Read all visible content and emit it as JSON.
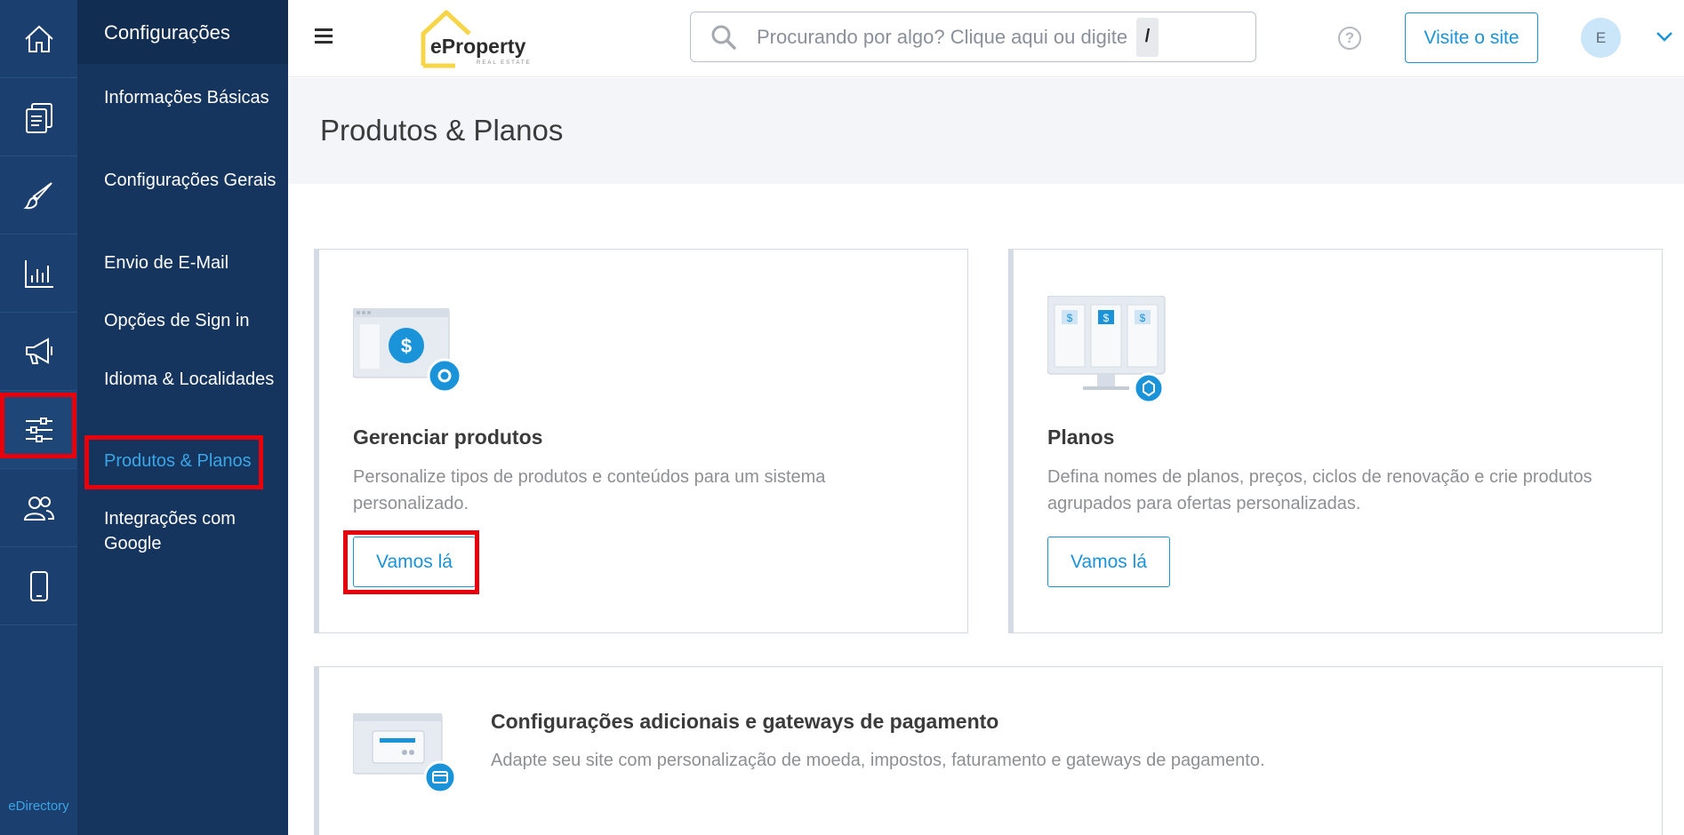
{
  "rail": {
    "items": [
      {
        "icon": "home-icon"
      },
      {
        "icon": "content-icon"
      },
      {
        "icon": "brush-icon"
      },
      {
        "icon": "reports-icon"
      },
      {
        "icon": "megaphone-icon"
      },
      {
        "icon": "settings-sliders-icon"
      },
      {
        "icon": "users-icon"
      },
      {
        "icon": "mobile-icon"
      }
    ],
    "brand": "eDirectory"
  },
  "sidebar": {
    "title": "Configurações",
    "items": [
      {
        "label": "Informações Básicas"
      },
      {
        "label": "Configurações Gerais"
      },
      {
        "label": "Envio de E-Mail"
      },
      {
        "label": "Opções de Sign in"
      },
      {
        "label": "Idioma & Localidades"
      },
      {
        "label": "Produtos & Planos"
      },
      {
        "label": "Integrações com Google"
      }
    ]
  },
  "header": {
    "logo_text": "eProperty",
    "logo_sub": "REAL ESTATE",
    "search_placeholder": "Procurando por algo? Clique aqui ou digite",
    "search_shortcut": "/",
    "visit_label": "Visite o site",
    "avatar_initial": "E"
  },
  "page": {
    "title": "Produtos & Planos"
  },
  "cards": [
    {
      "title": "Gerenciar produtos",
      "desc_line1": "Personalize tipos de produtos e conteúdos para um sistema",
      "desc_line2": "personalizado.",
      "button": "Vamos lá"
    },
    {
      "title": "Planos",
      "desc_line1": "Defina nomes de planos, preços, ciclos de renovação e crie produtos",
      "desc_line2": "agrupados para ofertas personalizadas.",
      "button": "Vamos lá"
    },
    {
      "title": "Configurações adicionais e gateways de pagamento",
      "desc_line1": "Adapte seu site com personalização de moeda, impostos, faturamento e gateways de pagamento."
    }
  ],
  "colors": {
    "rail_bg": "#1b3f6e",
    "sidebar_bg": "#15355f",
    "accent": "#1a93d8",
    "highlight": "#e8000b"
  }
}
